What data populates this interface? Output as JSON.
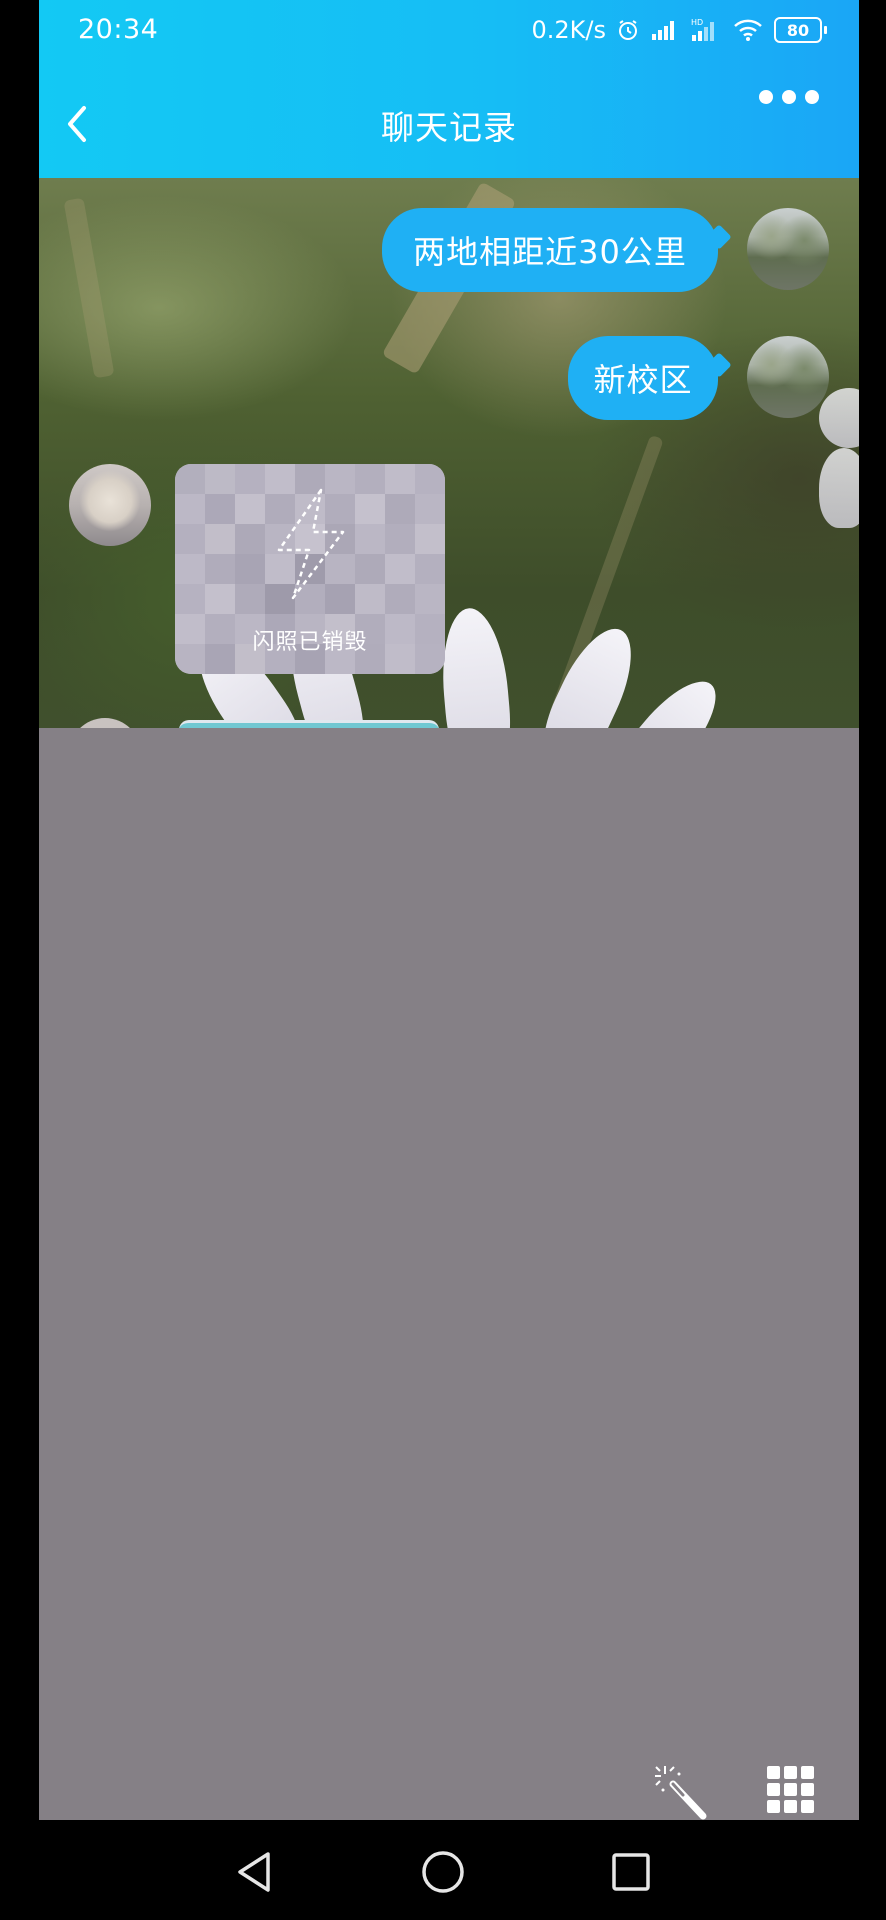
{
  "status_bar": {
    "time": "20:34",
    "net_speed": "0.2K/s",
    "battery": "80"
  },
  "header": {
    "title": "聊天记录",
    "back_icon": "chevron-left-icon",
    "more_icon": "more-dots-icon"
  },
  "messages": [
    {
      "sender": "self",
      "type": "text",
      "text": "两地相距近30公里"
    },
    {
      "sender": "self",
      "type": "text",
      "text": "新校区"
    },
    {
      "sender": "other",
      "type": "flash-photo",
      "text": "闪照已销毁",
      "icon": "lightning-icon"
    }
  ],
  "toolbar": {
    "magic_icon": "magic-wand-icon",
    "apps_icon": "grid-icon"
  },
  "nav_bar": {
    "back_icon": "triangle-back-icon",
    "home_icon": "circle-home-icon",
    "recents_icon": "square-recents-icon"
  },
  "colors": {
    "header_start": "#13c9f4",
    "header_end": "#1aa6f6",
    "bubble": "#1fb0f4",
    "panel": "#858086"
  }
}
